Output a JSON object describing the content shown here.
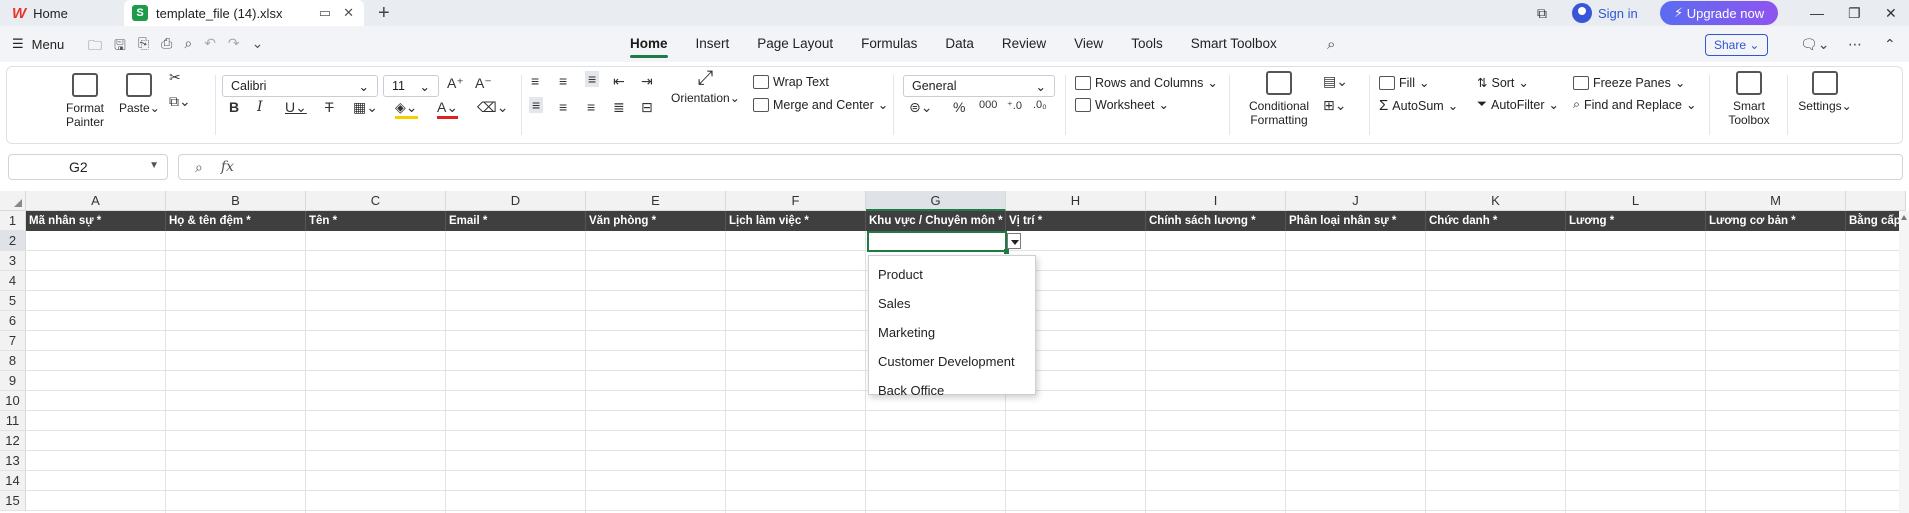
{
  "titlebar": {
    "home_tab": "Home",
    "file_tab": "template_file (14).xlsx",
    "sign_in": "Sign in",
    "upgrade": "Upgrade now"
  },
  "menubar": {
    "menu_label": "Menu",
    "tabs": [
      "Home",
      "Insert",
      "Page Layout",
      "Formulas",
      "Data",
      "Review",
      "View",
      "Tools",
      "Smart Toolbox"
    ],
    "active_tab": "Home",
    "share": "Share"
  },
  "ribbon": {
    "format_painter": "Format Painter",
    "paste": "Paste",
    "font_name": "Calibri",
    "font_size": "11",
    "wrap_text": "Wrap Text",
    "merge_center": "Merge and Center",
    "orientation": "Orientation",
    "number_format": "General",
    "rows_columns": "Rows and Columns",
    "worksheet": "Worksheet",
    "conditional_formatting": "Conditional Formatting",
    "fill": "Fill",
    "autosum": "AutoSum",
    "sort": "Sort",
    "autofilter": "AutoFilter",
    "freeze_panes": "Freeze Panes",
    "find_replace": "Find and Replace",
    "smart_toolbox": "Smart Toolbox",
    "settings": "Settings"
  },
  "formula_bar": {
    "name_box": "G2",
    "fx": "fx",
    "value": ""
  },
  "sheet": {
    "columns": [
      "A",
      "B",
      "C",
      "D",
      "E",
      "F",
      "G",
      "H",
      "I",
      "J",
      "K",
      "L",
      "M"
    ],
    "selected_column": "G",
    "rows": [
      "1",
      "2",
      "3",
      "4",
      "5",
      "6",
      "7",
      "8",
      "9",
      "10",
      "11",
      "12",
      "13",
      "14",
      "15"
    ],
    "selected_row": "2",
    "headers": [
      "Mã nhân sự *",
      "Họ & tên đệm *",
      "Tên *",
      "Email *",
      "Văn phòng *",
      "Lịch làm việc *",
      "Khu vực / Chuyên môn *",
      "Vị trí *",
      "Chính sách lương *",
      "Phân loại nhân sự *",
      "Chức danh *",
      "Lương *",
      "Lương cơ bản *",
      "Bằng cấp"
    ],
    "dropdown_options": [
      "Product",
      "Sales",
      "Marketing",
      "Customer Development",
      "Back Office"
    ]
  },
  "colors": {
    "accent": "#1f7a45",
    "header_fill": "#3f3f3f",
    "upgrade": "#6a5df0"
  }
}
